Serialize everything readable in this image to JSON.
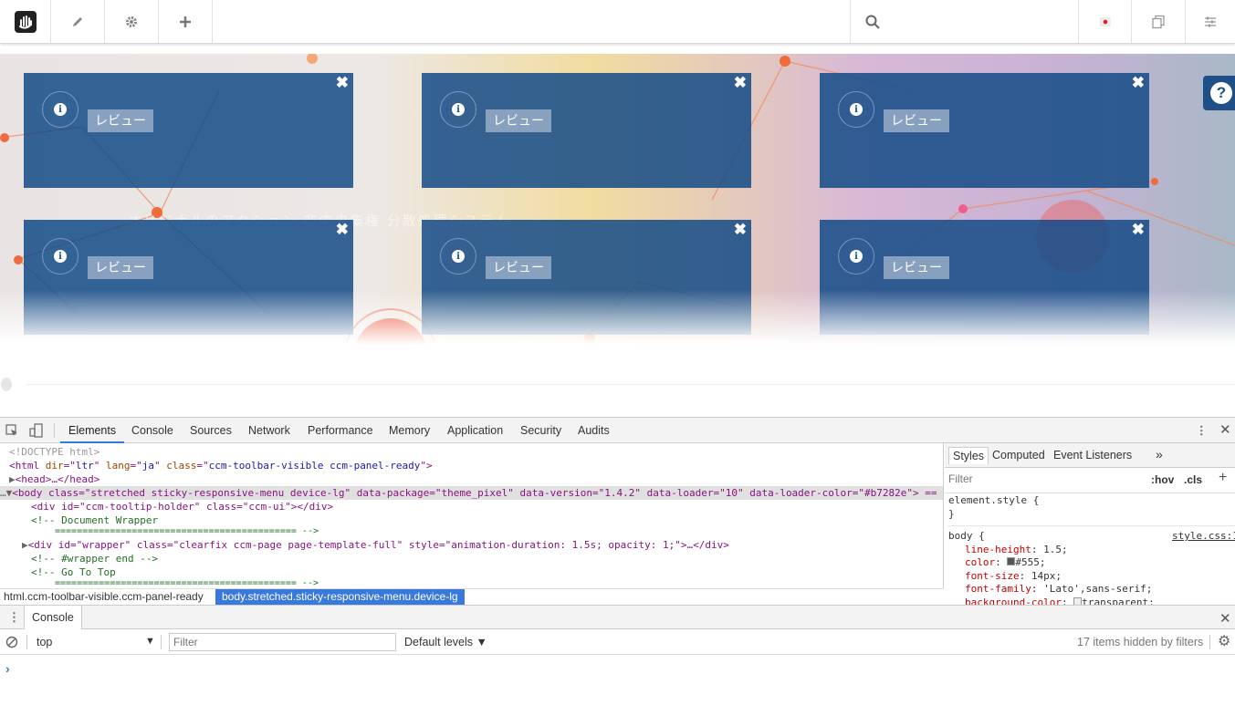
{
  "toolbar": {
    "logo_icon": "concrete5-hand-icon",
    "edit_icon": "pencil-icon",
    "settings_icon": "gear-icon",
    "add_icon": "plus-icon",
    "search_icon": "search-icon",
    "status_icon": "red-dot-icon",
    "copy_icon": "copy-icon",
    "panel_icon": "sliders-icon"
  },
  "hero": {
    "panels": [
      {
        "label": "レビュー"
      },
      {
        "label": "レビュー"
      },
      {
        "label": "レビュー"
      },
      {
        "label": "レビュー"
      },
      {
        "label": "レビュー"
      },
      {
        "label": "レビュー"
      }
    ],
    "close_glyph": "✖",
    "info_glyph": "i",
    "help_glyph": "?",
    "bg_text": "オリジナルのアクション 非中央集権 分散処理システム"
  },
  "devtools": {
    "tabs": [
      "Elements",
      "Console",
      "Sources",
      "Network",
      "Performance",
      "Memory",
      "Application",
      "Security",
      "Audits"
    ],
    "active_tab": "Elements",
    "elements_lines": {
      "l1": "<!DOCTYPE html>",
      "l2a": "<html ",
      "l2b": "dir",
      "l2c": "=\"",
      "l2d": "ltr",
      "l2e": "\" ",
      "l2f": "lang",
      "l2g": "ja",
      "l2h": "class",
      "l2i": "ccm-toolbar-visible ccm-panel-ready",
      "l2j": "\">",
      "l3": "<head>…</head>",
      "l4": "<body class=\"stretched sticky-responsive-menu device-lg\" data-package=\"theme_pixel\" data-version=\"1.4.2\" data-loader=\"10\" data-loader-color=\"#b7282e\"> ==",
      "l5": "<div id=\"ccm-tooltip-holder\" class=\"ccm-ui\"></div>",
      "l6": "<!-- Document Wrapper",
      "l7": "============================================ -->",
      "l8": "<div id=\"wrapper\" class=\"clearfix ccm-page page-template-full\" style=\"animation-duration: 1.5s; opacity: 1;\">…</div>",
      "l9": "<!-- #wrapper end -->",
      "l10": "<!-- Go To Top",
      "l11": "============================================ -->"
    },
    "breadcrumbs": [
      "html.ccm-toolbar-visible.ccm-panel-ready",
      "body.stretched.sticky-responsive-menu.device-lg"
    ],
    "styles": {
      "tabs": [
        "Styles",
        "Computed",
        "Event Listeners",
        "»"
      ],
      "filter_placeholder": "Filter",
      "hov": ":hov",
      "cls": ".cls",
      "plus": "+",
      "element_style": "element.style {",
      "close_brace": "}",
      "body_selector": "body {",
      "source": "style.css:1",
      "props": [
        {
          "name": "line-height",
          "value": "1.5;"
        },
        {
          "name": "color",
          "value": "#555;"
        },
        {
          "name": "font-size",
          "value": "14px;"
        },
        {
          "name": "font-family",
          "value": "'Lato',sans-serif;"
        },
        {
          "name": "background-color",
          "value": "transparent;"
        }
      ]
    },
    "console": {
      "title": "Console",
      "context": "top",
      "filter_placeholder": "Filter",
      "levels": "Default levels ▼",
      "hidden": "17 items hidden by filters",
      "prompt": "›"
    }
  }
}
